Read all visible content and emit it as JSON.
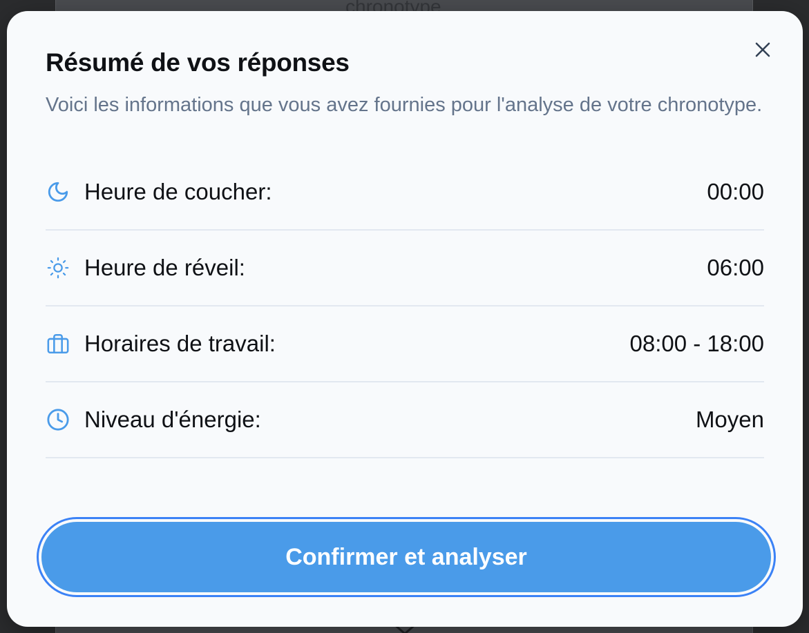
{
  "background": {
    "partial_text": "chronotype"
  },
  "modal": {
    "title": "Résumé de vos réponses",
    "subtitle": "Voici les informations que vous avez fournies pour l'analyse de votre chronotype.",
    "close_icon": "close-icon",
    "rows": [
      {
        "icon": "moon-icon",
        "label": "Heure de coucher:",
        "value": "00:00"
      },
      {
        "icon": "sun-icon",
        "label": "Heure de réveil:",
        "value": "06:00"
      },
      {
        "icon": "briefcase-icon",
        "label": "Horaires de travail:",
        "value": "08:00 - 18:00"
      },
      {
        "icon": "clock-icon",
        "label": "Niveau d'énergie:",
        "value": "Moyen"
      }
    ],
    "confirm_label": "Confirmer et analyser"
  },
  "colors": {
    "accent": "#4a9be9",
    "icon": "#4a9be9",
    "muted_text": "#64748b",
    "divider": "#e2e8f0"
  }
}
